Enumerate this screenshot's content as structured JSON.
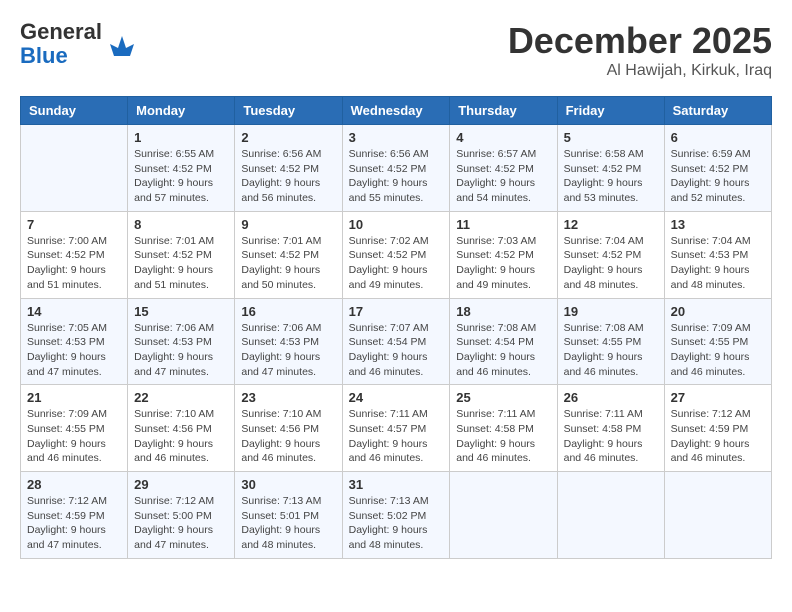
{
  "header": {
    "logo_general": "General",
    "logo_blue": "Blue",
    "month_title": "December 2025",
    "location": "Al Hawijah, Kirkuk, Iraq"
  },
  "days_of_week": [
    "Sunday",
    "Monday",
    "Tuesday",
    "Wednesday",
    "Thursday",
    "Friday",
    "Saturday"
  ],
  "weeks": [
    [
      {
        "day": "",
        "info": ""
      },
      {
        "day": "1",
        "info": "Sunrise: 6:55 AM\nSunset: 4:52 PM\nDaylight: 9 hours\nand 57 minutes."
      },
      {
        "day": "2",
        "info": "Sunrise: 6:56 AM\nSunset: 4:52 PM\nDaylight: 9 hours\nand 56 minutes."
      },
      {
        "day": "3",
        "info": "Sunrise: 6:56 AM\nSunset: 4:52 PM\nDaylight: 9 hours\nand 55 minutes."
      },
      {
        "day": "4",
        "info": "Sunrise: 6:57 AM\nSunset: 4:52 PM\nDaylight: 9 hours\nand 54 minutes."
      },
      {
        "day": "5",
        "info": "Sunrise: 6:58 AM\nSunset: 4:52 PM\nDaylight: 9 hours\nand 53 minutes."
      },
      {
        "day": "6",
        "info": "Sunrise: 6:59 AM\nSunset: 4:52 PM\nDaylight: 9 hours\nand 52 minutes."
      }
    ],
    [
      {
        "day": "7",
        "info": "Sunrise: 7:00 AM\nSunset: 4:52 PM\nDaylight: 9 hours\nand 51 minutes."
      },
      {
        "day": "8",
        "info": "Sunrise: 7:01 AM\nSunset: 4:52 PM\nDaylight: 9 hours\nand 51 minutes."
      },
      {
        "day": "9",
        "info": "Sunrise: 7:01 AM\nSunset: 4:52 PM\nDaylight: 9 hours\nand 50 minutes."
      },
      {
        "day": "10",
        "info": "Sunrise: 7:02 AM\nSunset: 4:52 PM\nDaylight: 9 hours\nand 49 minutes."
      },
      {
        "day": "11",
        "info": "Sunrise: 7:03 AM\nSunset: 4:52 PM\nDaylight: 9 hours\nand 49 minutes."
      },
      {
        "day": "12",
        "info": "Sunrise: 7:04 AM\nSunset: 4:52 PM\nDaylight: 9 hours\nand 48 minutes."
      },
      {
        "day": "13",
        "info": "Sunrise: 7:04 AM\nSunset: 4:53 PM\nDaylight: 9 hours\nand 48 minutes."
      }
    ],
    [
      {
        "day": "14",
        "info": "Sunrise: 7:05 AM\nSunset: 4:53 PM\nDaylight: 9 hours\nand 47 minutes."
      },
      {
        "day": "15",
        "info": "Sunrise: 7:06 AM\nSunset: 4:53 PM\nDaylight: 9 hours\nand 47 minutes."
      },
      {
        "day": "16",
        "info": "Sunrise: 7:06 AM\nSunset: 4:53 PM\nDaylight: 9 hours\nand 47 minutes."
      },
      {
        "day": "17",
        "info": "Sunrise: 7:07 AM\nSunset: 4:54 PM\nDaylight: 9 hours\nand 46 minutes."
      },
      {
        "day": "18",
        "info": "Sunrise: 7:08 AM\nSunset: 4:54 PM\nDaylight: 9 hours\nand 46 minutes."
      },
      {
        "day": "19",
        "info": "Sunrise: 7:08 AM\nSunset: 4:55 PM\nDaylight: 9 hours\nand 46 minutes."
      },
      {
        "day": "20",
        "info": "Sunrise: 7:09 AM\nSunset: 4:55 PM\nDaylight: 9 hours\nand 46 minutes."
      }
    ],
    [
      {
        "day": "21",
        "info": "Sunrise: 7:09 AM\nSunset: 4:55 PM\nDaylight: 9 hours\nand 46 minutes."
      },
      {
        "day": "22",
        "info": "Sunrise: 7:10 AM\nSunset: 4:56 PM\nDaylight: 9 hours\nand 46 minutes."
      },
      {
        "day": "23",
        "info": "Sunrise: 7:10 AM\nSunset: 4:56 PM\nDaylight: 9 hours\nand 46 minutes."
      },
      {
        "day": "24",
        "info": "Sunrise: 7:11 AM\nSunset: 4:57 PM\nDaylight: 9 hours\nand 46 minutes."
      },
      {
        "day": "25",
        "info": "Sunrise: 7:11 AM\nSunset: 4:58 PM\nDaylight: 9 hours\nand 46 minutes."
      },
      {
        "day": "26",
        "info": "Sunrise: 7:11 AM\nSunset: 4:58 PM\nDaylight: 9 hours\nand 46 minutes."
      },
      {
        "day": "27",
        "info": "Sunrise: 7:12 AM\nSunset: 4:59 PM\nDaylight: 9 hours\nand 46 minutes."
      }
    ],
    [
      {
        "day": "28",
        "info": "Sunrise: 7:12 AM\nSunset: 4:59 PM\nDaylight: 9 hours\nand 47 minutes."
      },
      {
        "day": "29",
        "info": "Sunrise: 7:12 AM\nSunset: 5:00 PM\nDaylight: 9 hours\nand 47 minutes."
      },
      {
        "day": "30",
        "info": "Sunrise: 7:13 AM\nSunset: 5:01 PM\nDaylight: 9 hours\nand 48 minutes."
      },
      {
        "day": "31",
        "info": "Sunrise: 7:13 AM\nSunset: 5:02 PM\nDaylight: 9 hours\nand 48 minutes."
      },
      {
        "day": "",
        "info": ""
      },
      {
        "day": "",
        "info": ""
      },
      {
        "day": "",
        "info": ""
      }
    ]
  ]
}
